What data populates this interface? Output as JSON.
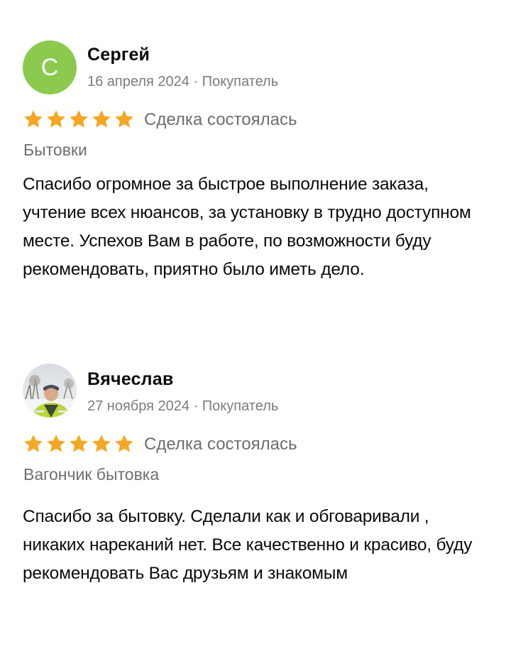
{
  "reviews": [
    {
      "avatar_letter": "С",
      "avatar_color": "#8cc94f",
      "author": "Сергей",
      "meta": "16 апреля 2024 · Покупатель",
      "rating": 5,
      "deal_status": "Сделка состоялась",
      "item": "Бытовки",
      "text": "Спасибо огромное за быстрое выполнение заказа, учтение всех нюансов, за установку в трудно доступном месте. Успехов Вам в работе, по возможности буду рекомендовать, приятно было иметь дело."
    },
    {
      "avatar_letter": "",
      "author": "Вячеслав",
      "meta": "27 ноября 2024 · Покупатель",
      "rating": 5,
      "deal_status": "Сделка состоялась",
      "item": "Вагончик бытовка",
      "text": "Спасибо за бытовку. Сделали как и обговаривали , никаких нареканий нет. Все качественно и красиво, буду рекомендовать Вас друзьям и знакомым"
    }
  ],
  "icons": {
    "star": "star-icon",
    "star_color": "#f5a623"
  }
}
